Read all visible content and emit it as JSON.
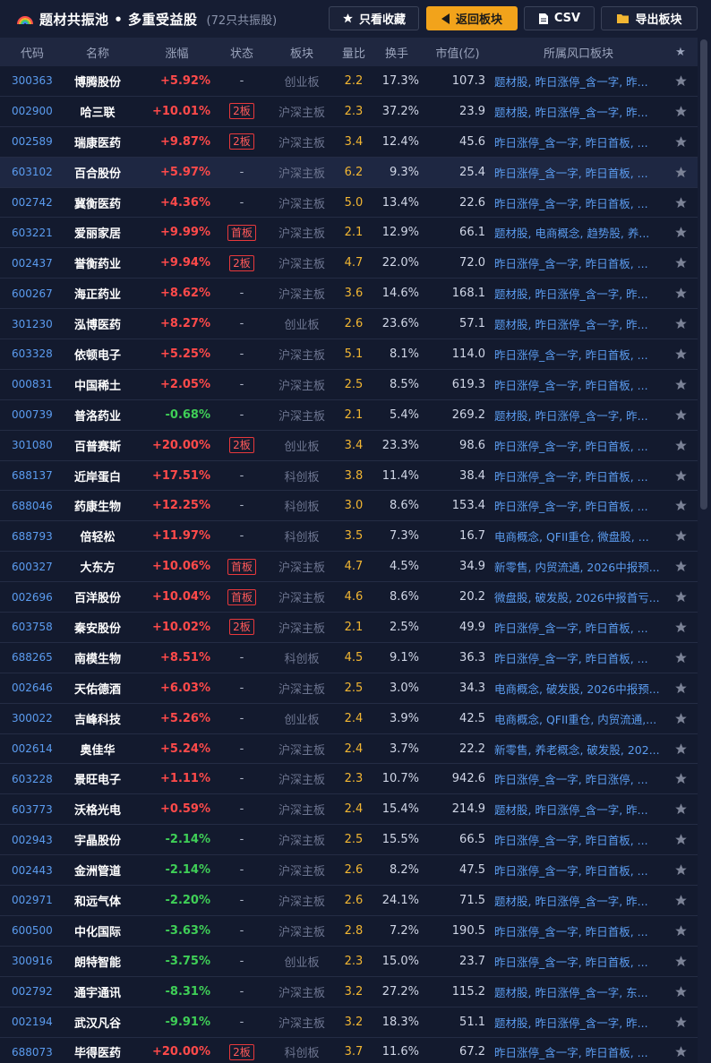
{
  "header": {
    "title": "题材共振池 • 多重受益股",
    "count": "(72只共振股)",
    "buttons": {
      "favorites": "只看收藏",
      "back": "返回板块",
      "csv": "CSV",
      "export": "导出板块"
    },
    "accent_color": "#f2a31b"
  },
  "columns": [
    "代码",
    "名称",
    "涨幅",
    "状态",
    "板块",
    "量比",
    "换手",
    "市值(亿)",
    "所属风口板块",
    "★"
  ],
  "selected_row_index": 3,
  "rows": [
    {
      "code": "300363",
      "name": "博腾股份",
      "change": "+5.92%",
      "dir": "up",
      "status": "-",
      "board": "创业板",
      "ratio": "2.2",
      "turnover": "17.3%",
      "cap": "107.3",
      "sectors": "题材股, 昨日涨停_含一字, 昨..."
    },
    {
      "code": "002900",
      "name": "哈三联",
      "change": "+10.01%",
      "dir": "up",
      "status": "2板",
      "board": "沪深主板",
      "ratio": "2.3",
      "turnover": "37.2%",
      "cap": "23.9",
      "sectors": "题材股, 昨日涨停_含一字, 昨..."
    },
    {
      "code": "002589",
      "name": "瑞康医药",
      "change": "+9.87%",
      "dir": "up",
      "status": "2板",
      "board": "沪深主板",
      "ratio": "3.4",
      "turnover": "12.4%",
      "cap": "45.6",
      "sectors": "昨日涨停_含一字, 昨日首板, ..."
    },
    {
      "code": "603102",
      "name": "百合股份",
      "change": "+5.97%",
      "dir": "up",
      "status": "-",
      "board": "沪深主板",
      "ratio": "6.2",
      "turnover": "9.3%",
      "cap": "25.4",
      "sectors": "昨日涨停_含一字, 昨日首板, ..."
    },
    {
      "code": "002742",
      "name": "冀衡医药",
      "change": "+4.36%",
      "dir": "up",
      "status": "-",
      "board": "沪深主板",
      "ratio": "5.0",
      "turnover": "13.4%",
      "cap": "22.6",
      "sectors": "昨日涨停_含一字, 昨日首板, ..."
    },
    {
      "code": "603221",
      "name": "爱丽家居",
      "change": "+9.99%",
      "dir": "up",
      "status": "首板",
      "board": "沪深主板",
      "ratio": "2.1",
      "turnover": "12.9%",
      "cap": "66.1",
      "sectors": "题材股, 电商概念, 趋势股, 养..."
    },
    {
      "code": "002437",
      "name": "誉衡药业",
      "change": "+9.94%",
      "dir": "up",
      "status": "2板",
      "board": "沪深主板",
      "ratio": "4.7",
      "turnover": "22.0%",
      "cap": "72.0",
      "sectors": "昨日涨停_含一字, 昨日首板, ..."
    },
    {
      "code": "600267",
      "name": "海正药业",
      "change": "+8.62%",
      "dir": "up",
      "status": "-",
      "board": "沪深主板",
      "ratio": "3.6",
      "turnover": "14.6%",
      "cap": "168.1",
      "sectors": "题材股, 昨日涨停_含一字, 昨..."
    },
    {
      "code": "301230",
      "name": "泓博医药",
      "change": "+8.27%",
      "dir": "up",
      "status": "-",
      "board": "创业板",
      "ratio": "2.6",
      "turnover": "23.6%",
      "cap": "57.1",
      "sectors": "题材股, 昨日涨停_含一字, 昨..."
    },
    {
      "code": "603328",
      "name": "依顿电子",
      "change": "+5.25%",
      "dir": "up",
      "status": "-",
      "board": "沪深主板",
      "ratio": "5.1",
      "turnover": "8.1%",
      "cap": "114.0",
      "sectors": "昨日涨停_含一字, 昨日首板, ..."
    },
    {
      "code": "000831",
      "name": "中国稀土",
      "change": "+2.05%",
      "dir": "up",
      "status": "-",
      "board": "沪深主板",
      "ratio": "2.5",
      "turnover": "8.5%",
      "cap": "619.3",
      "sectors": "昨日涨停_含一字, 昨日首板, ..."
    },
    {
      "code": "000739",
      "name": "普洛药业",
      "change": "-0.68%",
      "dir": "down",
      "status": "-",
      "board": "沪深主板",
      "ratio": "2.1",
      "turnover": "5.4%",
      "cap": "269.2",
      "sectors": "题材股, 昨日涨停_含一字, 昨..."
    },
    {
      "code": "301080",
      "name": "百普赛斯",
      "change": "+20.00%",
      "dir": "up",
      "status": "2板",
      "board": "创业板",
      "ratio": "3.4",
      "turnover": "23.3%",
      "cap": "98.6",
      "sectors": "昨日涨停_含一字, 昨日首板, ..."
    },
    {
      "code": "688137",
      "name": "近岸蛋白",
      "change": "+17.51%",
      "dir": "up",
      "status": "-",
      "board": "科创板",
      "ratio": "3.8",
      "turnover": "11.4%",
      "cap": "38.4",
      "sectors": "昨日涨停_含一字, 昨日首板, ..."
    },
    {
      "code": "688046",
      "name": "药康生物",
      "change": "+12.25%",
      "dir": "up",
      "status": "-",
      "board": "科创板",
      "ratio": "3.0",
      "turnover": "8.6%",
      "cap": "153.4",
      "sectors": "昨日涨停_含一字, 昨日首板, ..."
    },
    {
      "code": "688793",
      "name": "倍轻松",
      "change": "+11.97%",
      "dir": "up",
      "status": "-",
      "board": "科创板",
      "ratio": "3.5",
      "turnover": "7.3%",
      "cap": "16.7",
      "sectors": "电商概念, QFII重仓, 微盘股, ..."
    },
    {
      "code": "600327",
      "name": "大东方",
      "change": "+10.06%",
      "dir": "up",
      "status": "首板",
      "board": "沪深主板",
      "ratio": "4.7",
      "turnover": "4.5%",
      "cap": "34.9",
      "sectors": "新零售, 内贸流通, 2026中报预..."
    },
    {
      "code": "002696",
      "name": "百洋股份",
      "change": "+10.04%",
      "dir": "up",
      "status": "首板",
      "board": "沪深主板",
      "ratio": "4.6",
      "turnover": "8.6%",
      "cap": "20.2",
      "sectors": "微盘股, 破发股, 2026中报首亏..."
    },
    {
      "code": "603758",
      "name": "秦安股份",
      "change": "+10.02%",
      "dir": "up",
      "status": "2板",
      "board": "沪深主板",
      "ratio": "2.1",
      "turnover": "2.5%",
      "cap": "49.9",
      "sectors": "昨日涨停_含一字, 昨日首板, ..."
    },
    {
      "code": "688265",
      "name": "南模生物",
      "change": "+8.51%",
      "dir": "up",
      "status": "-",
      "board": "科创板",
      "ratio": "4.5",
      "turnover": "9.1%",
      "cap": "36.3",
      "sectors": "昨日涨停_含一字, 昨日首板, ..."
    },
    {
      "code": "002646",
      "name": "天佑德酒",
      "change": "+6.03%",
      "dir": "up",
      "status": "-",
      "board": "沪深主板",
      "ratio": "2.5",
      "turnover": "3.0%",
      "cap": "34.3",
      "sectors": "电商概念, 破发股, 2026中报预..."
    },
    {
      "code": "300022",
      "name": "吉峰科技",
      "change": "+5.26%",
      "dir": "up",
      "status": "-",
      "board": "创业板",
      "ratio": "2.4",
      "turnover": "3.9%",
      "cap": "42.5",
      "sectors": "电商概念, QFII重仓, 内贸流通,..."
    },
    {
      "code": "002614",
      "name": "奥佳华",
      "change": "+5.24%",
      "dir": "up",
      "status": "-",
      "board": "沪深主板",
      "ratio": "2.4",
      "turnover": "3.7%",
      "cap": "22.2",
      "sectors": "新零售, 养老概念, 破发股, 202..."
    },
    {
      "code": "603228",
      "name": "景旺电子",
      "change": "+1.11%",
      "dir": "up",
      "status": "-",
      "board": "沪深主板",
      "ratio": "2.3",
      "turnover": "10.7%",
      "cap": "942.6",
      "sectors": "昨日涨停_含一字, 昨日涨停, ..."
    },
    {
      "code": "603773",
      "name": "沃格光电",
      "change": "+0.59%",
      "dir": "up",
      "status": "-",
      "board": "沪深主板",
      "ratio": "2.4",
      "turnover": "15.4%",
      "cap": "214.9",
      "sectors": "题材股, 昨日涨停_含一字, 昨..."
    },
    {
      "code": "002943",
      "name": "宇晶股份",
      "change": "-2.14%",
      "dir": "down",
      "status": "-",
      "board": "沪深主板",
      "ratio": "2.5",
      "turnover": "15.5%",
      "cap": "66.5",
      "sectors": "昨日涨停_含一字, 昨日首板, ..."
    },
    {
      "code": "002443",
      "name": "金洲管道",
      "change": "-2.14%",
      "dir": "down",
      "status": "-",
      "board": "沪深主板",
      "ratio": "2.6",
      "turnover": "8.2%",
      "cap": "47.5",
      "sectors": "昨日涨停_含一字, 昨日首板, ..."
    },
    {
      "code": "002971",
      "name": "和远气体",
      "change": "-2.20%",
      "dir": "down",
      "status": "-",
      "board": "沪深主板",
      "ratio": "2.6",
      "turnover": "24.1%",
      "cap": "71.5",
      "sectors": "题材股, 昨日涨停_含一字, 昨..."
    },
    {
      "code": "600500",
      "name": "中化国际",
      "change": "-3.63%",
      "dir": "down",
      "status": "-",
      "board": "沪深主板",
      "ratio": "2.8",
      "turnover": "7.2%",
      "cap": "190.5",
      "sectors": "昨日涨停_含一字, 昨日首板, ..."
    },
    {
      "code": "300916",
      "name": "朗特智能",
      "change": "-3.75%",
      "dir": "down",
      "status": "-",
      "board": "创业板",
      "ratio": "2.3",
      "turnover": "15.0%",
      "cap": "23.7",
      "sectors": "昨日涨停_含一字, 昨日首板, ..."
    },
    {
      "code": "002792",
      "name": "通宇通讯",
      "change": "-8.31%",
      "dir": "down",
      "status": "-",
      "board": "沪深主板",
      "ratio": "3.2",
      "turnover": "27.2%",
      "cap": "115.2",
      "sectors": "题材股, 昨日涨停_含一字, 东..."
    },
    {
      "code": "002194",
      "name": "武汉凡谷",
      "change": "-9.91%",
      "dir": "down",
      "status": "-",
      "board": "沪深主板",
      "ratio": "3.2",
      "turnover": "18.3%",
      "cap": "51.1",
      "sectors": "题材股, 昨日涨停_含一字, 昨..."
    },
    {
      "code": "688073",
      "name": "毕得医药",
      "change": "+20.00%",
      "dir": "up",
      "status": "2板",
      "board": "科创板",
      "ratio": "3.7",
      "turnover": "11.6%",
      "cap": "67.2",
      "sectors": "昨日涨停_含一字, 昨日首板, ..."
    }
  ]
}
